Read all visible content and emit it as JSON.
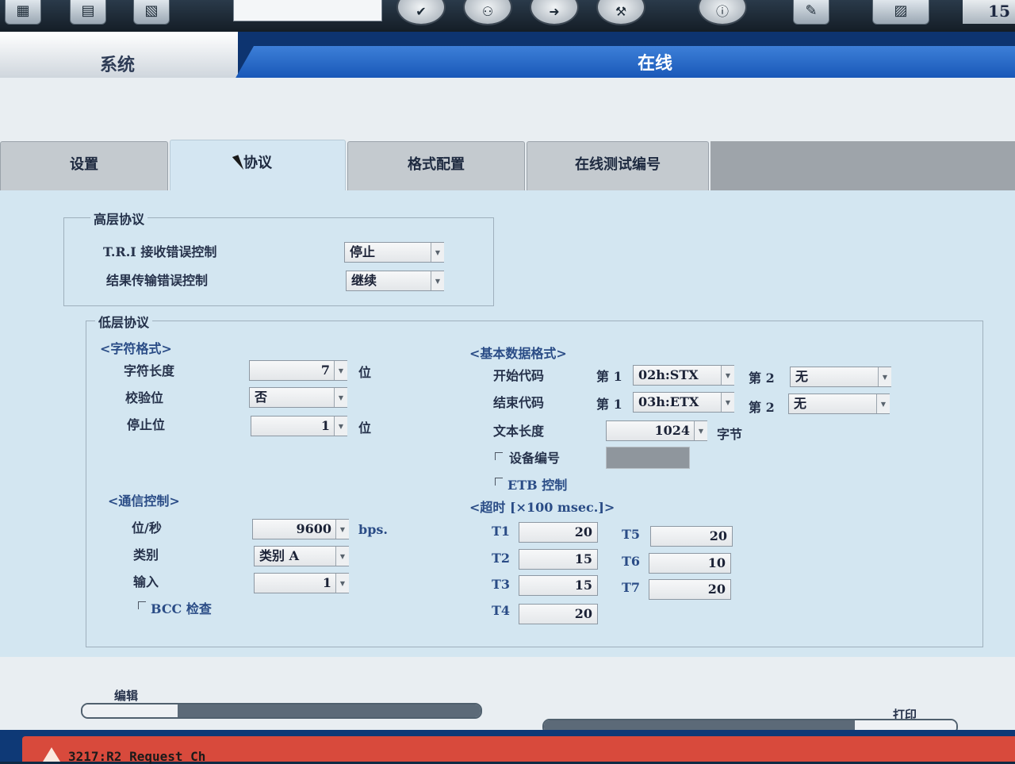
{
  "toolbar": {
    "counter": "15"
  },
  "titlebar": {
    "left_title": "系统",
    "right_title": "在线"
  },
  "tabs": [
    {
      "label": "设置"
    },
    {
      "label": "协议"
    },
    {
      "label": "格式配置"
    },
    {
      "label": "在线测试编号"
    }
  ],
  "high_protocol": {
    "title": "高层协议",
    "tri_label": "T.R.I 接收错误控制",
    "tri_value": "停止",
    "result_label": "结果传输错误控制",
    "result_value": "继续"
  },
  "low_protocol": {
    "title": "低层协议",
    "char_format": {
      "title": "<字符格式>",
      "length_label": "字符长度",
      "length_value": "7",
      "length_unit": "位",
      "parity_label": "校验位",
      "parity_value": "否",
      "stop_label": "停止位",
      "stop_value": "1",
      "stop_unit": "位"
    },
    "comm": {
      "title": "<通信控制>",
      "bps_label": "位/秒",
      "bps_value": "9600",
      "bps_unit": "bps.",
      "type_label": "类别",
      "type_value": "类别 A",
      "input_label": "输入",
      "input_value": "1",
      "bcc_label": "BCC 检查"
    },
    "basic": {
      "title": "<基本数据格式>",
      "start_label": "开始代码",
      "end_label": "结束代码",
      "first_label": "第 1",
      "second_label": "第 2",
      "start_first": "02h:STX",
      "start_second": "无",
      "end_first": "03h:ETX",
      "end_second": "无",
      "text_len_label": "文本长度",
      "text_len_value": "1024",
      "text_len_unit": "字节",
      "device_label": "设备编号",
      "etb_label": "ETB 控制"
    },
    "timeout": {
      "title": "<超时 [×100 msec.]>",
      "items": [
        {
          "label": "T1",
          "value": "20"
        },
        {
          "label": "T2",
          "value": "15"
        },
        {
          "label": "T3",
          "value": "15"
        },
        {
          "label": "T4",
          "value": "20"
        },
        {
          "label": "T5",
          "value": "20"
        },
        {
          "label": "T6",
          "value": "10"
        },
        {
          "label": "T7",
          "value": "20"
        }
      ]
    }
  },
  "bottom": {
    "edit_label": "编辑",
    "print_label": "打印"
  },
  "footer": {
    "message": "3217:R2 Request Ch"
  }
}
